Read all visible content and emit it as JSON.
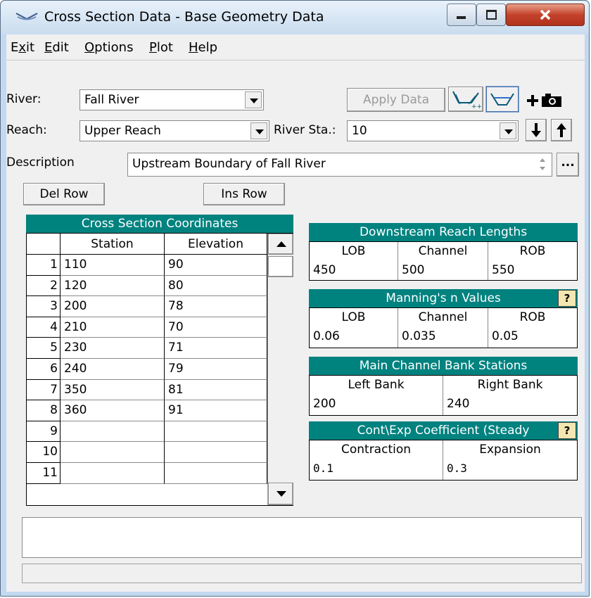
{
  "window": {
    "title": "Cross Section Data - Base Geometry Data"
  },
  "menu": {
    "items": [
      {
        "pre": "E",
        "u": "x",
        "post": "it"
      },
      {
        "pre": "",
        "u": "E",
        "post": "dit"
      },
      {
        "pre": "",
        "u": "O",
        "post": "ptions"
      },
      {
        "pre": "",
        "u": "P",
        "post": "lot"
      },
      {
        "pre": "",
        "u": "H",
        "post": "elp"
      }
    ]
  },
  "river": {
    "label": "River:",
    "value": "Fall River"
  },
  "reach": {
    "label": "Reach:",
    "value": "Upper Reach"
  },
  "river_sta": {
    "label": "River Sta.:",
    "value": "10"
  },
  "apply_button": "Apply Data",
  "description": {
    "label": "Description",
    "value": "Upstream Boundary of Fall River",
    "more_button": "..."
  },
  "table_buttons": {
    "del_row": "Del Row",
    "ins_row": "Ins Row"
  },
  "coords": {
    "title": "Cross Section Coordinates",
    "headers": [
      "Station",
      "Elevation"
    ],
    "rows": [
      {
        "n": "1",
        "station": "110",
        "elev": "90"
      },
      {
        "n": "2",
        "station": "120",
        "elev": "80"
      },
      {
        "n": "3",
        "station": "200",
        "elev": "78"
      },
      {
        "n": "4",
        "station": "210",
        "elev": "70"
      },
      {
        "n": "5",
        "station": "230",
        "elev": "71"
      },
      {
        "n": "6",
        "station": "240",
        "elev": "79"
      },
      {
        "n": "7",
        "station": "350",
        "elev": "81"
      },
      {
        "n": "8",
        "station": "360",
        "elev": "91"
      },
      {
        "n": "9",
        "station": "",
        "elev": ""
      },
      {
        "n": "10",
        "station": "",
        "elev": ""
      },
      {
        "n": "11",
        "station": "",
        "elev": ""
      }
    ]
  },
  "reach_lengths": {
    "title": "Downstream Reach Lengths",
    "headers": [
      "LOB",
      "Channel",
      "ROB"
    ],
    "values": [
      "450",
      "500",
      "550"
    ]
  },
  "mannings": {
    "title": "Manning's n Values",
    "headers": [
      "LOB",
      "Channel",
      "ROB"
    ],
    "values": [
      "0.06",
      "0.035",
      "0.05"
    ],
    "help": "?"
  },
  "bank_stations": {
    "title": "Main Channel Bank Stations",
    "headers": [
      "Left Bank",
      "Right Bank"
    ],
    "values": [
      "200",
      "240"
    ]
  },
  "coefficients": {
    "title": "Cont\\Exp Coefficient (Steady",
    "headers": [
      "Contraction",
      "Expansion"
    ],
    "values": [
      "0.1",
      "0.3"
    ],
    "help": "?"
  },
  "colors": {
    "teal": "#00827f",
    "accent_close": "#c4422b"
  },
  "icons": [
    "window-menu-icon",
    "minimize-icon",
    "maximize-icon",
    "close-icon",
    "interpolate-icon",
    "water-surface-icon",
    "plus-icon",
    "camera-icon",
    "arrow-down-icon",
    "arrow-up-icon"
  ]
}
